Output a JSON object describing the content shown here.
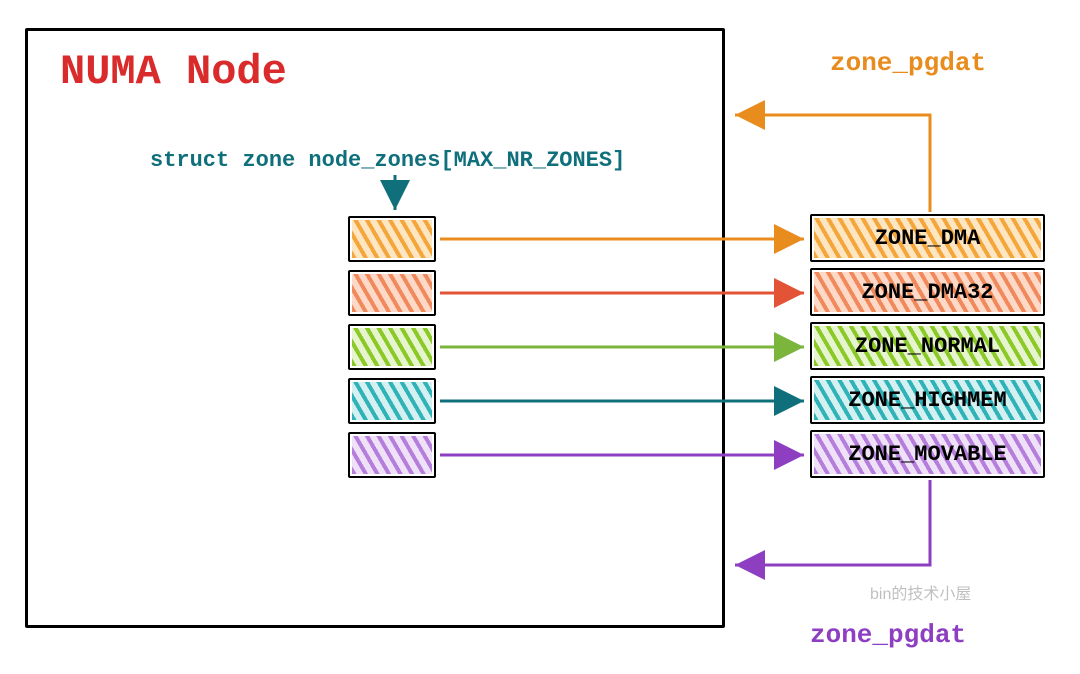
{
  "title": "NUMA Node",
  "struct_label": "struct zone node_zones[MAX_NR_ZONES]",
  "top_label": "zone_pgdat",
  "bottom_label": "zone_pgdat",
  "watermark": "bin的技术小屋",
  "zones": {
    "dma": "ZONE_DMA",
    "dma32": "ZONE_DMA32",
    "normal": "ZONE_NORMAL",
    "highmem": "ZONE_HIGHMEM",
    "movable": "ZONE_MOVABLE"
  },
  "colors": {
    "orange": "#e98c1e",
    "red": "#e35336",
    "green": "#7bb53c",
    "teal": "#0f6f7a",
    "purple": "#8e3fc1"
  }
}
